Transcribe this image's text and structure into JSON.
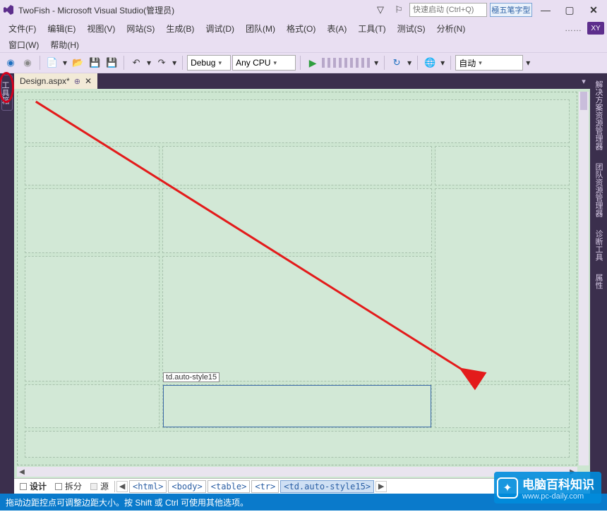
{
  "title_bar": {
    "title": "TwoFish - Microsoft Visual Studio(管理员)",
    "quick_launch_placeholder": "快速启动 (Ctrl+Q)",
    "ime_label": "極五笔字型",
    "minimize": "—",
    "restore": "▢",
    "close": "✕"
  },
  "menu": {
    "items": [
      "文件(F)",
      "编辑(E)",
      "视图(V)",
      "网站(S)",
      "生成(B)",
      "调试(D)",
      "团队(M)",
      "格式(O)",
      "表(A)",
      "工具(T)",
      "测试(S)",
      "分析(N)"
    ],
    "items2": [
      "窗口(W)",
      "帮助(H)"
    ],
    "user_hint": "……",
    "xy": "XY"
  },
  "toolbar": {
    "back": "◀",
    "forward": "▶",
    "new": "⎘",
    "open": "📂",
    "save": "💾",
    "saveall": "💾",
    "undo": "↶",
    "redo": "↷",
    "config_label": "Debug",
    "platform_label": "Any CPU",
    "run": "▶",
    "browser": "⎙",
    "auto_label": "自动"
  },
  "left_rail": {
    "toolbox": "工具箱"
  },
  "right_rail": {
    "tabs": [
      "解决方案资源管理器",
      "团队资源管理器",
      "诊断工具",
      "属性"
    ]
  },
  "document": {
    "tab_label": "Design.aspx*",
    "pin": "⊕",
    "close": "✕",
    "overflow": "▾"
  },
  "design_surface": {
    "selected_cell_tag": "td.auto-style15"
  },
  "view_tabs": {
    "design": "设计",
    "split": "拆分",
    "source": "源"
  },
  "breadcrumb": {
    "items": [
      "<html>",
      "<body>",
      "<table>",
      "<tr>",
      "<td.auto-style15>"
    ]
  },
  "status_bar": {
    "text": "拖动边距控点可调整边距大小。按 Shift 或 Ctrl 可使用其他选项。"
  },
  "watermark": {
    "text": "电脑百科知识",
    "url": "www.pc-daily.com"
  }
}
